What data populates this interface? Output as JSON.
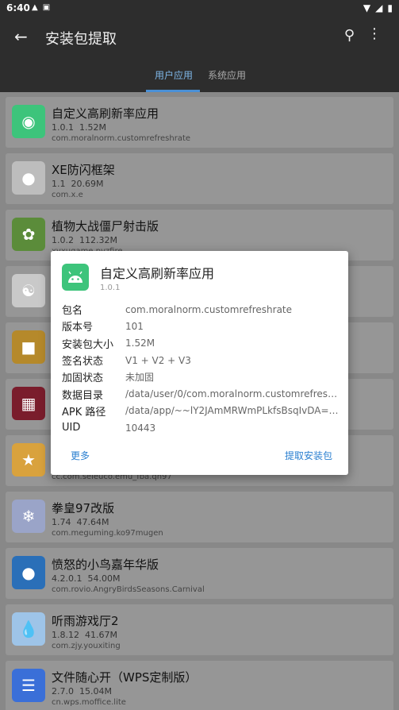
{
  "status": {
    "time": "6:40"
  },
  "appbar": {
    "title": "安装包提取"
  },
  "tabs": [
    {
      "label": "用户应用"
    },
    {
      "label": "系统应用"
    }
  ],
  "apps": [
    {
      "name": "自定义高刷新率应用",
      "version": "1.0.1",
      "size": "1.52M",
      "package": "com.moralnorm.customrefreshrate",
      "icon_color": "#3dc47b"
    },
    {
      "name": "XE防闪框架",
      "version": "1.1",
      "size": "20.69M",
      "package": "com.x.e",
      "icon_color": "#bdbdbd"
    },
    {
      "name": "植物大战僵尸射击版",
      "version": "1.0.2",
      "size": "112.32M",
      "package": "xyxugame.pvzfire",
      "icon_color": "#5b8c3a"
    },
    {
      "name": "",
      "version": "",
      "size": "",
      "package": "",
      "icon_color": "#c9c9c9"
    },
    {
      "name": "",
      "version": "",
      "size": "",
      "package": "",
      "icon_color": "#b5892b"
    },
    {
      "name": "",
      "version": "",
      "size": "",
      "package": "",
      "icon_color": "#7a1d2c"
    },
    {
      "name": "",
      "version": "",
      "size": "",
      "package": "cc.com.seleuco.emu_fba.qh97",
      "icon_color": "#d9a23d"
    },
    {
      "name": "拳皇97改版",
      "version": "1.74",
      "size": "47.64M",
      "package": "com.meguming.ko97mugen",
      "icon_color": "#9aa4c8"
    },
    {
      "name": "愤怒的小鸟嘉年华版",
      "version": "4.2.0.1",
      "size": "54.00M",
      "package": "com.rovio.AngryBirdsSeasons.Carnival",
      "icon_color": "#2a6fb8"
    },
    {
      "name": "听雨游戏厅2",
      "version": "1.8.12",
      "size": "41.67M",
      "package": "com.zjy.youxiting",
      "icon_color": "#9ec4e8"
    },
    {
      "name": "文件随心开（WPS定制版）",
      "version": "2.7.0",
      "size": "15.04M",
      "package": "cn.wps.moffice.lite",
      "icon_color": "#3a6fd8"
    }
  ],
  "dialog": {
    "title": "自定义高刷新率应用",
    "version": "1.0.1",
    "rows": [
      {
        "key": "包名",
        "value": "com.moralnorm.customrefreshrate"
      },
      {
        "key": "版本号",
        "value": "101"
      },
      {
        "key": "安装包大小",
        "value": "1.52M"
      },
      {
        "key": "签名状态",
        "value": "V1 + V2 + V3"
      },
      {
        "key": "加固状态",
        "value": "未加固"
      },
      {
        "key": "数据目录",
        "value": "/data/user/0/com.moralnorm.customrefresh..."
      },
      {
        "key": "APK 路径",
        "value": "/data/app/~~lY2JAmMRWmPLkfsBsqIvDA==..."
      },
      {
        "key": "UID",
        "value": "10443"
      }
    ],
    "more_label": "更多",
    "extract_label": "提取安装包"
  }
}
